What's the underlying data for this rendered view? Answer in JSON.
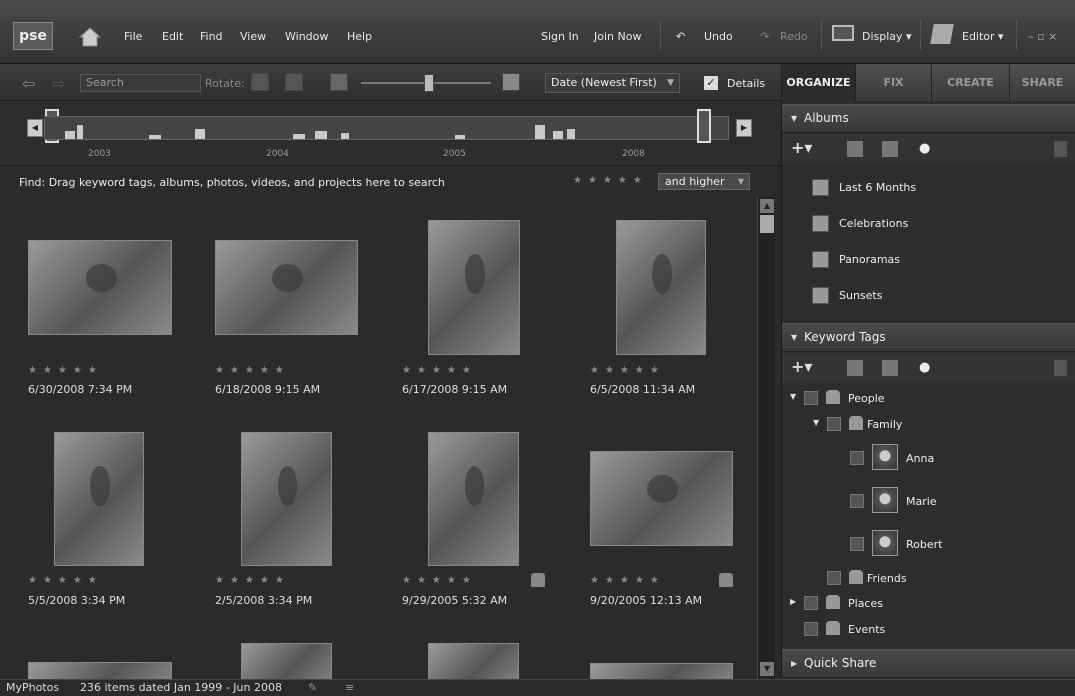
{
  "app": {
    "logo": "pse"
  },
  "menu": {
    "items": [
      "File",
      "Edit",
      "Find",
      "View",
      "Window",
      "Help"
    ]
  },
  "top_right": {
    "sign_in": "Sign In",
    "join_now": "Join Now",
    "undo": "Undo",
    "redo": "Redo",
    "display": "Display ▾",
    "editor": "Editor ▾",
    "window_controls": "– ▫ ×"
  },
  "toolbar": {
    "search_placeholder": "Search",
    "rotate_label": "Rotate:",
    "sort": "Date (Newest First)",
    "details_check": "✓",
    "details_label": "Details"
  },
  "tabs": [
    "ORGANIZE",
    "FIX",
    "CREATE",
    "SHARE"
  ],
  "timeline": {
    "years": [
      "2003",
      "2004",
      "2005",
      "2008"
    ]
  },
  "find": {
    "text": "Find: Drag keyword tags, albums, photos, videos, and projects here to search",
    "stars": "★★★★★",
    "rating": "and higher"
  },
  "photos": [
    {
      "date": "6/30/2008 7:34 PM",
      "stars": "★★★★★",
      "tagged": false
    },
    {
      "date": "6/18/2008 9:15 AM",
      "stars": "★★★★★",
      "tagged": false
    },
    {
      "date": "6/17/2008 9:15 AM",
      "stars": "★★★★★",
      "tagged": false
    },
    {
      "date": "6/5/2008 11:34 AM",
      "stars": "★★★★★",
      "tagged": false
    },
    {
      "date": "5/5/2008 3:34 PM",
      "stars": "★★★★★",
      "tagged": false
    },
    {
      "date": "2/5/2008 3:34 PM",
      "stars": "★★★★★",
      "tagged": false
    },
    {
      "date": "9/29/2005 5:32 AM",
      "stars": "★★★★★",
      "tagged": true
    },
    {
      "date": "9/20/2005 12:13 AM",
      "stars": "★★★★★",
      "tagged": true
    }
  ],
  "albums": {
    "header": "Albums",
    "items": [
      "Last 6 Months",
      "Celebrations",
      "Panoramas",
      "Sunsets"
    ]
  },
  "keywords": {
    "header": "Keyword Tags",
    "people": "People",
    "family": "Family",
    "anna": "Anna",
    "marie": "Marie",
    "robert": "Robert",
    "friends": "Friends",
    "places": "Places",
    "events": "Events"
  },
  "quick_share": {
    "header": "Quick Share"
  },
  "status": {
    "catalog": "MyPhotos",
    "items": "236 items dated Jan 1999 - Jun 2008"
  }
}
